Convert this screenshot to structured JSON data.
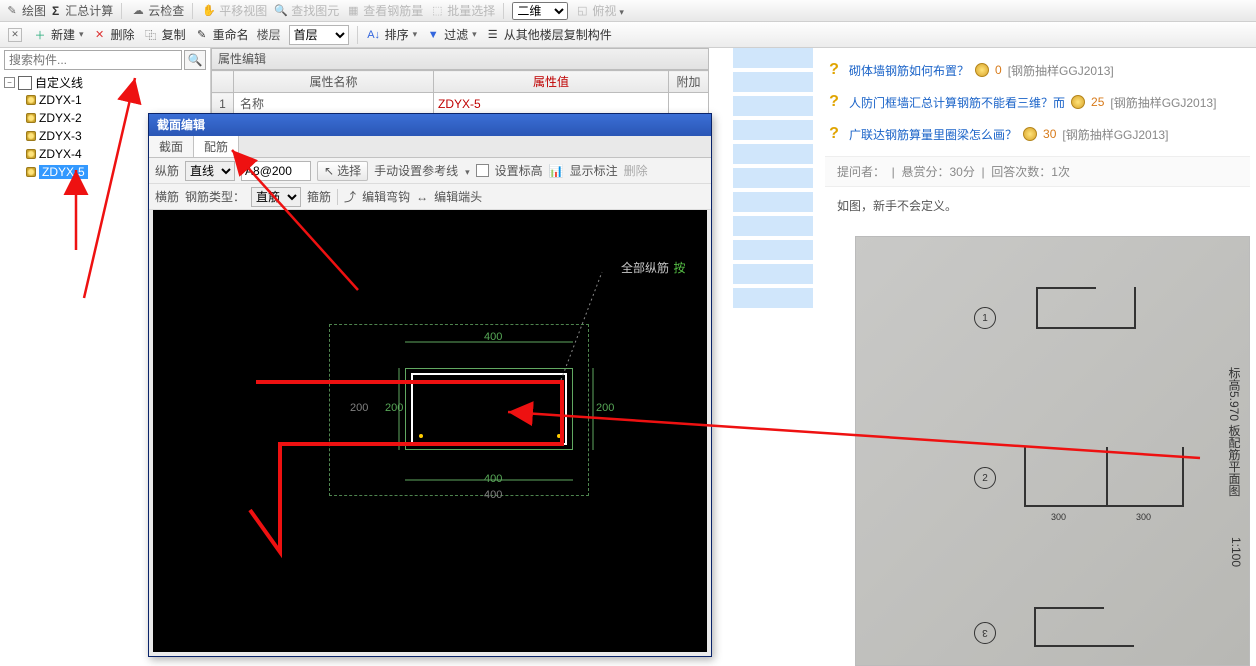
{
  "topbar1": {
    "draw": "绘图",
    "sum": "汇总计算",
    "cloud": "云检查",
    "pan": "平移视图",
    "findElem": "查找图元",
    "viewRebar": "查看钢筋量",
    "batchSel": "批量选择",
    "dim_sel": "二维",
    "view_sel": "俯视"
  },
  "topbar2": {
    "new": "新建",
    "del": "删除",
    "copy": "复制",
    "rename": "重命名",
    "floor": "楼层",
    "floor_sel": "首层",
    "sort": "排序",
    "filter": "过滤",
    "copyFrom": "从其他楼层复制构件"
  },
  "search": {
    "placeholder": "搜索构件..."
  },
  "tree": {
    "root": "自定义线",
    "items": [
      "ZDYX-1",
      "ZDYX-2",
      "ZDYX-3",
      "ZDYX-4",
      "ZDYX-5"
    ],
    "selected": 4
  },
  "prop": {
    "panel_title": "属性编辑",
    "head_name": "属性名称",
    "head_value": "属性值",
    "head_extra": "附加",
    "row1_num": "1",
    "row1_name": "名称",
    "row1_value": "ZDYX-5"
  },
  "dlg": {
    "title": "截面编辑",
    "tab_section": "截面",
    "tab_rebar": "配筋",
    "row1_label": "纵筋",
    "row1_sel": "直线",
    "row1_spec": "A8@200",
    "row1_select": "选择",
    "row1_manual": "手动设置参考线",
    "row1_setElev": "设置标高",
    "row1_showAnno": "显示标注",
    "row1_delete": "删除",
    "row2_label": "横筋",
    "row2_type": "钢筋类型：",
    "row2_sel": "直筋",
    "row2_stirrup": "箍筋",
    "row2_editHook": "编辑弯钩",
    "row2_editEnd": "编辑端头",
    "canvas_all": "全部纵筋",
    "canvas_hint": "按",
    "dim400": "400",
    "dim200": "200"
  },
  "qa": {
    "items": [
      {
        "link": "砌体墙钢筋如何布置？",
        "pts": "0",
        "tag": "[钢筋抽样GGJ2013]"
      },
      {
        "link": "人防门框墙汇总计算钢筋不能看三维？而",
        "pts": "25",
        "tag": "[钢筋抽样GGJ2013]"
      },
      {
        "link": "广联达钢筋算量里圈梁怎么画？",
        "pts": "30",
        "tag": "[钢筋抽样GGJ2013]"
      }
    ],
    "meta_asker": "提问者：",
    "meta_bounty": "悬赏分：30分",
    "meta_answers": "回答次数：1次",
    "desc": "如图，新手不会定义。",
    "photo_caption": "标高5.970 板配筋平面图",
    "photo_scale": "1:100"
  }
}
